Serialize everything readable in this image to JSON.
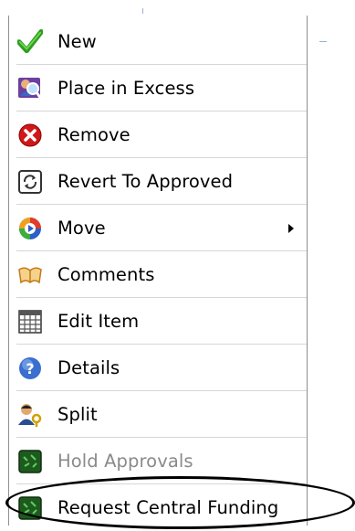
{
  "menu": {
    "items": [
      {
        "label": "New",
        "icon": "checkmark-icon",
        "enabled": true
      },
      {
        "label": "Place in Excess",
        "icon": "magnifier-person-icon",
        "enabled": true
      },
      {
        "label": "Remove",
        "icon": "remove-x-icon",
        "enabled": true
      },
      {
        "label": "Revert To Approved",
        "icon": "revert-cycle-icon",
        "enabled": true
      },
      {
        "label": "Move",
        "icon": "move-arrow-icon",
        "enabled": true,
        "has_submenu": true
      },
      {
        "label": "Comments",
        "icon": "book-comments-icon",
        "enabled": true
      },
      {
        "label": "Edit Item",
        "icon": "grid-calendar-icon",
        "enabled": true
      },
      {
        "label": "Details",
        "icon": "help-question-icon",
        "enabled": true
      },
      {
        "label": "Split",
        "icon": "person-key-icon",
        "enabled": true
      },
      {
        "label": "Hold Approvals",
        "icon": "green-board-icon",
        "enabled": false
      },
      {
        "label": "Request Central Funding",
        "icon": "green-board-icon",
        "enabled": true,
        "circled": true
      }
    ]
  },
  "colors": {
    "disabled_text": "#8a8a8a",
    "separator": "#d6d6d6",
    "oval": "#000000"
  }
}
